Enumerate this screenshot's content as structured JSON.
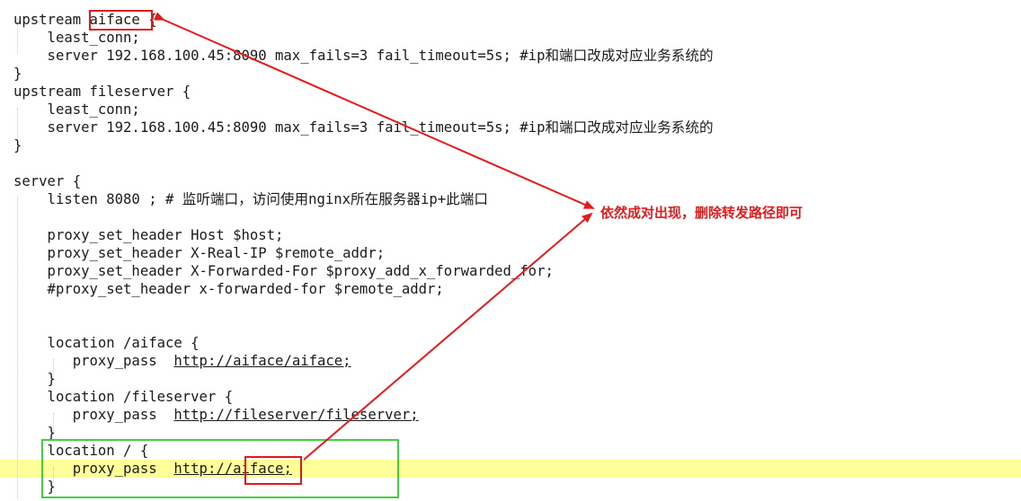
{
  "code_lines": [
    "upstream aiface {",
    "    least_conn;",
    "    server 192.168.100.45:8090 max_fails=3 fail_timeout=5s; #ip和端口改成对应业务系统的",
    "}",
    "upstream fileserver {",
    "    least_conn;",
    "    server 192.168.100.45:8090 max_fails=3 fail_timeout=5s; #ip和端口改成对应业务系统的",
    "}",
    "",
    "server {",
    "    listen 8080 ; # 监听端口，访问使用nginx所在服务器ip+此端口",
    "",
    "    proxy_set_header Host $host;",
    "    proxy_set_header X-Real-IP $remote_addr;",
    "    proxy_set_header X-Forwarded-For $proxy_add_x_forwarded_for;",
    "    #proxy_set_header x-forwarded-for $remote_addr;",
    "",
    "",
    "    location /aiface {",
    "       proxy_pass  ",
    "    }",
    "    location /fileserver {",
    "       proxy_pass  ",
    "    }",
    "    location / {",
    "       proxy_pass  ",
    "    }"
  ],
  "links": {
    "aiface": "http://aiface/aiface;",
    "fileserver": "http://fileserver/fileserver;",
    "root": "http://aiface;"
  },
  "annotation": "依然成对出现，删除转发路径即可",
  "colors": {
    "annotation_red": "#e6191b",
    "highlight_yellow": "#ffff99",
    "box_green": "#3fcf3f"
  }
}
